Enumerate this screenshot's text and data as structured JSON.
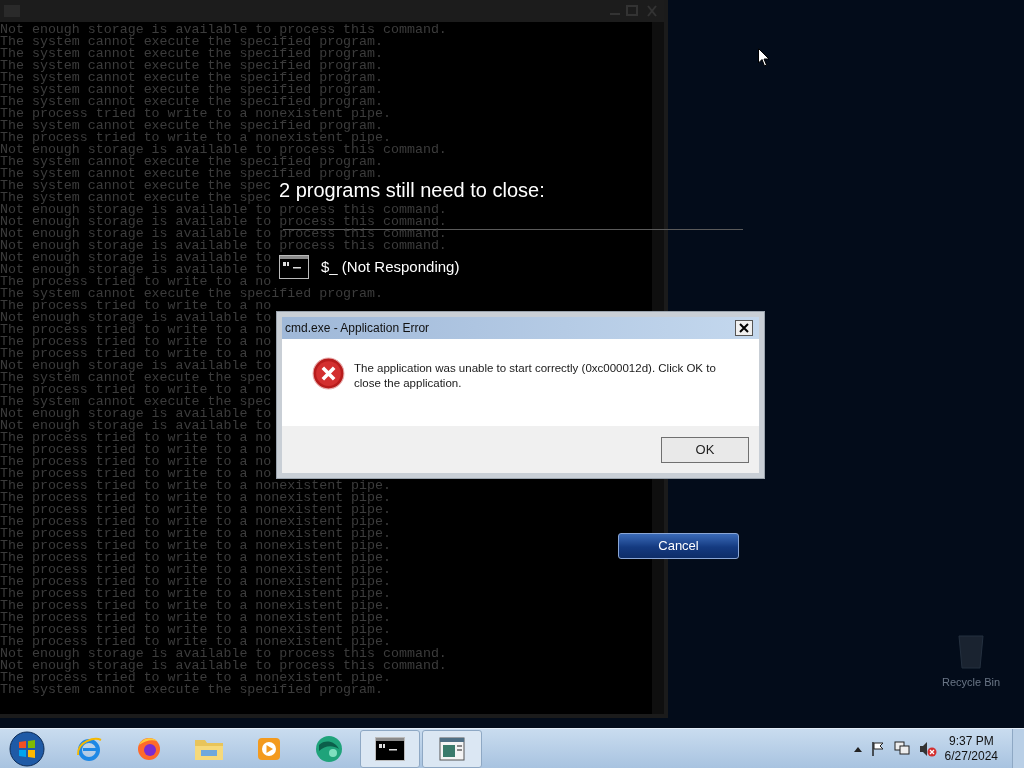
{
  "console": {
    "lines": [
      "Not enough storage is available to process this command.",
      "The system cannot execute the specified program.",
      "The system cannot execute the specified program.",
      "The system cannot execute the specified program.",
      "The system cannot execute the specified program.",
      "The system cannot execute the specified program.",
      "The system cannot execute the specified program.",
      "The process tried to write to a nonexistent pipe.",
      "The system cannot execute the specified program.",
      "The process tried to write to a nonexistent pipe.",
      "Not enough storage is available to process this command.",
      "The system cannot execute the specified program.",
      "The system cannot execute the specified program.",
      "The system cannot execute the spec",
      "The system cannot execute the spec",
      "Not enough storage is available to process this command.",
      "Not enough storage is available to process this command.",
      "Not enough storage is available to process this command.",
      "Not enough storage is available to process this command.",
      "Not enough storage is available to",
      "Not enough storage is available to",
      "The process tried to write to a no",
      "The system cannot execute the specified program.",
      "The process tried to write to a no",
      "Not enough storage is available to",
      "The process tried to write to a no",
      "The process tried to write to a no",
      "The process tried to write to a no",
      "Not enough storage is available to",
      "The system cannot execute the spec",
      "The process tried to write to a no",
      "The system cannot execute the spec",
      "Not enough storage is available to",
      "Not enough storage is available to",
      "The process tried to write to a no",
      "The process tried to write to a no",
      "The process tried to write to a no",
      "The process tried to write to a no",
      "The process tried to write to a nonexistent pipe.",
      "The process tried to write to a nonexistent pipe.",
      "The process tried to write to a nonexistent pipe.",
      "The process tried to write to a nonexistent pipe.",
      "The process tried to write to a nonexistent pipe.",
      "The process tried to write to a nonexistent pipe.",
      "The process tried to write to a nonexistent pipe.",
      "The process tried to write to a nonexistent pipe.",
      "The process tried to write to a nonexistent pipe.",
      "The process tried to write to a nonexistent pipe.",
      "The process tried to write to a nonexistent pipe.",
      "The process tried to write to a nonexistent pipe.",
      "The process tried to write to a nonexistent pipe.",
      "The process tried to write to a nonexistent pipe.",
      "Not enough storage is available to process this command.",
      "Not enough storage is available to process this command.",
      "The process tried to write to a nonexistent pipe.",
      "The system cannot execute the specified program."
    ]
  },
  "shutdown": {
    "heading": "2 programs still need to close:",
    "programs": [
      {
        "name": "$_ (Not Responding)"
      }
    ],
    "cancel": "Cancel"
  },
  "dialog": {
    "title": "cmd.exe - Application Error",
    "message": "The application was unable to start correctly (0xc000012d). Click OK to close the application.",
    "ok": "OK"
  },
  "desktop": {
    "icons": [
      {
        "label": "Recycle Bin"
      }
    ]
  },
  "taskbar": {
    "apps": [
      {
        "kind": "ie",
        "running": false
      },
      {
        "kind": "firefox",
        "running": false
      },
      {
        "kind": "folder",
        "running": false
      },
      {
        "kind": "media",
        "running": false
      },
      {
        "kind": "globe",
        "running": false
      },
      {
        "kind": "console",
        "running": true
      },
      {
        "kind": "window",
        "running": true
      }
    ],
    "clock": {
      "time": "9:37 PM",
      "date": "6/27/2024"
    }
  }
}
